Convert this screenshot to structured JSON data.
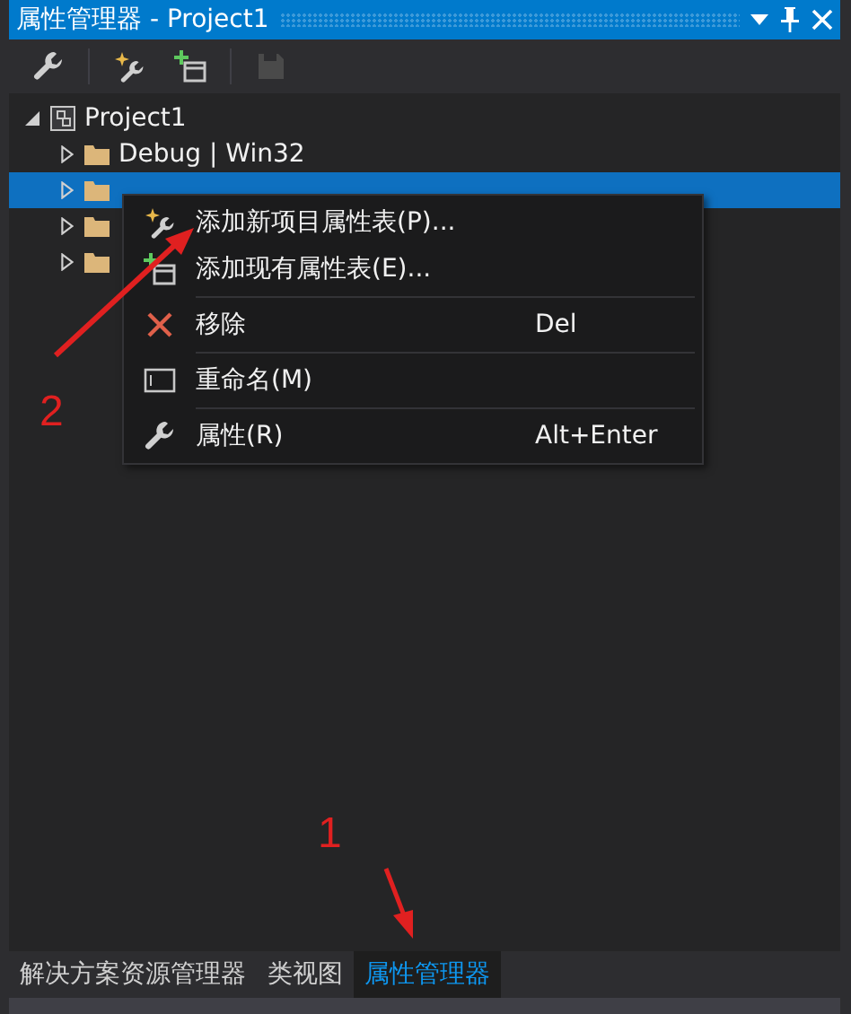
{
  "window": {
    "title": "属性管理器 - Project1"
  },
  "toolbar": [
    {
      "kind": "wrench",
      "disabled": false
    },
    {
      "kind": "new-sheet",
      "disabled": false
    },
    {
      "kind": "add-sheet",
      "disabled": false
    },
    {
      "kind": "save",
      "disabled": true
    }
  ],
  "tree": {
    "label": "Project1",
    "expanded": true,
    "children": [
      {
        "label": "Debug | Win32",
        "expanded": false,
        "selected": false
      },
      {
        "expanded": false,
        "selected": true
      },
      {
        "expanded": false,
        "selected": false
      },
      {
        "expanded": false,
        "selected": false
      }
    ]
  },
  "context_menu": [
    {
      "kind": "new-sheet",
      "label": "添加新项目属性表(P)...",
      "separator_before": false
    },
    {
      "kind": "add-sheet",
      "label": "添加现有属性表(E)...",
      "separator_before": false
    },
    {
      "kind": "remove",
      "label": "移除",
      "shortcut": "Del",
      "separator_before": true
    },
    {
      "kind": "rename",
      "label": "重命名(M)",
      "separator_before": true
    },
    {
      "kind": "wrench",
      "label": "属性(R)",
      "shortcut": "Alt+Enter",
      "separator_before": true
    }
  ],
  "tabs": [
    {
      "label": "解决方案资源管理器",
      "selected": false
    },
    {
      "label": "类视图",
      "selected": false
    },
    {
      "label": "属性管理器",
      "selected": true
    }
  ],
  "annotations": [
    {
      "label": "2"
    },
    {
      "label": "1"
    }
  ]
}
